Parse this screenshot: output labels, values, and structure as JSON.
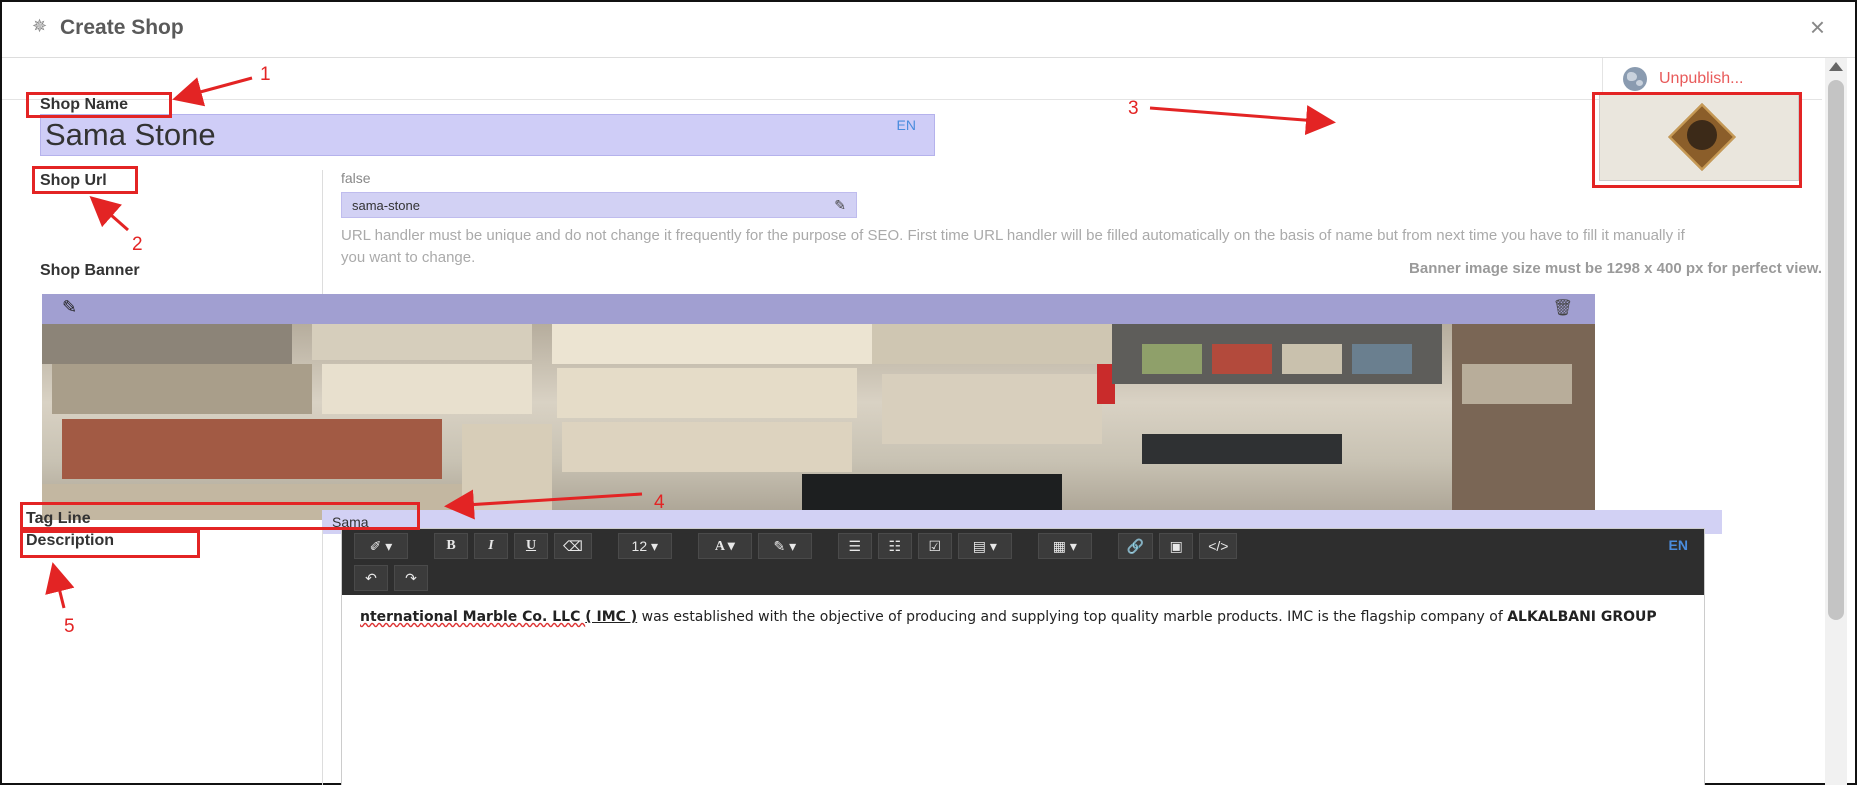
{
  "dialog": {
    "title": "Create Shop",
    "close_glyph": "×",
    "gear_glyph": "✵"
  },
  "publish": {
    "label": "Unpublish...",
    "icon": "globe-icon"
  },
  "shop_name": {
    "label": "Shop Name",
    "value": "Sama Stone",
    "lang": "EN"
  },
  "shop_url": {
    "label": "Shop Url",
    "status": "false",
    "value": "sama-stone",
    "help": "URL handler must be unique and do not change it frequently for the purpose of SEO. First time URL handler will be filled automatically on the basis of name but from next time you have to fill it manually if you want to change."
  },
  "shop_banner": {
    "label": "Shop Banner",
    "hint": "Banner image size must be 1298 x 400 px for perfect view."
  },
  "tag_line": {
    "label": "Tag Line",
    "value": "Sama"
  },
  "description": {
    "label": "Description",
    "lang": "EN",
    "toolbar": {
      "magic": "✐ ▾",
      "bold": "B",
      "italic": "I",
      "underline": "U",
      "eraser": "⌫",
      "font_size": "12 ▾",
      "font_color": "A ▾",
      "highlight": "✎ ▾",
      "ul": "☰",
      "ol": "☷",
      "check": "☑",
      "align": "▤ ▾",
      "table": "▦ ▾",
      "link": "🔗",
      "image": "▣",
      "code": "</>",
      "undo": "↶",
      "redo": "↷"
    },
    "body": {
      "part1": "nternational Marble Co. LLC ",
      "part2": "( IMC )",
      "part3": " was established with the objective of producing and supplying top quality marble products. IMC is the flagship company of ",
      "part4": "ALKALBANI GROUP"
    }
  },
  "annotations": {
    "n1": "1",
    "n2": "2",
    "n3": "3",
    "n4": "4",
    "n5": "5"
  },
  "colors": {
    "accent_red": "#e32424",
    "input_bg": "#cfcdf7",
    "toolbar_bg": "#2e2e2e",
    "link_blue": "#4a8cdd"
  }
}
